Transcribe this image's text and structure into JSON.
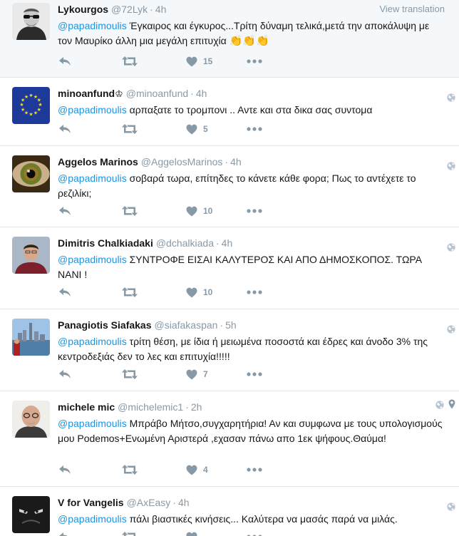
{
  "ui": {
    "view_translation": "View translation",
    "colors": {
      "mention": "#1b95e0",
      "muted": "#8899a6",
      "text": "#14171a",
      "divider": "#e1e8ed"
    }
  },
  "tweets": [
    {
      "name": "Lykourgos",
      "handle": "@72Lyk",
      "time": "4h",
      "mention": "@papadimoulis",
      "text": " Έγκαιρος και έγκυρος...Τρίτη δύναμη τελικά,μετά την αποκάλυψη με  τον Μαυρίκο άλλη μια μεγάλη επιτυχία ",
      "emoji": "👏👏👏",
      "likes": "15"
    },
    {
      "name": "minoanfund",
      "badge": "♔",
      "handle": "@minoanfund",
      "time": "4h",
      "mention": "@papadimoulis",
      "text": " αρπαξατε το τρομπονι .. Αντε και στα δικα σας συντομα",
      "likes": "5"
    },
    {
      "name": "Aggelos Marinos",
      "handle": "@AggelosMarinos",
      "time": "4h",
      "mention": "@papadimoulis",
      "text": " σοβαρά τωρα, επίτηδες το κάνετε κάθε φορα;  Πως το αντέχετε το ρεζιλίκι;",
      "likes": "10"
    },
    {
      "name": "Dimitris Chalkiadaki",
      "handle": "@dchalkiada",
      "time": "4h",
      "mention": "@papadimoulis",
      "text": " ΣΥΝΤΡΟΦΕ ΕΙΣΑΙ ΚΑΛΥΤΕΡΟΣ ΚΑΙ ΑΠΟ ΔΗΜΟΣΚΟΠΟΣ. ΤΩΡΑ ΝΑΝΙ !",
      "likes": "10"
    },
    {
      "name": "Panagiotis Siafakas",
      "handle": "@siafakaspan",
      "time": "5h",
      "mention": "@papadimoulis",
      "text": " τρίτη θέση, με ίδια ή μειωμένα ποσοστά και έδρες και άνοδο 3% της κεντροδεξιάς δεν το λες και επιτυχία!!!!!",
      "likes": "7"
    },
    {
      "name": "michele mic",
      "handle": "@michelemic1",
      "time": "2h",
      "mention": "@papadimoulis",
      "text": " Μπράβο Μήτσο,συγχαρητήρια! Αν και συμφωνα με τους υπολογισμούς μου Podemos+Ενωμένη Αριστερά ,εχασαν πάνω απο 1εκ ψήφους.Θαύμα!",
      "likes": "4"
    },
    {
      "name": "V for Vangelis",
      "handle": "@AxEasy",
      "time": "4h",
      "mention": "@papadimoulis",
      "text": " πάλι βιαστικές κινήσεις... Καλύτερα να μασάς παρά να μιλάς.",
      "likes": ""
    }
  ]
}
